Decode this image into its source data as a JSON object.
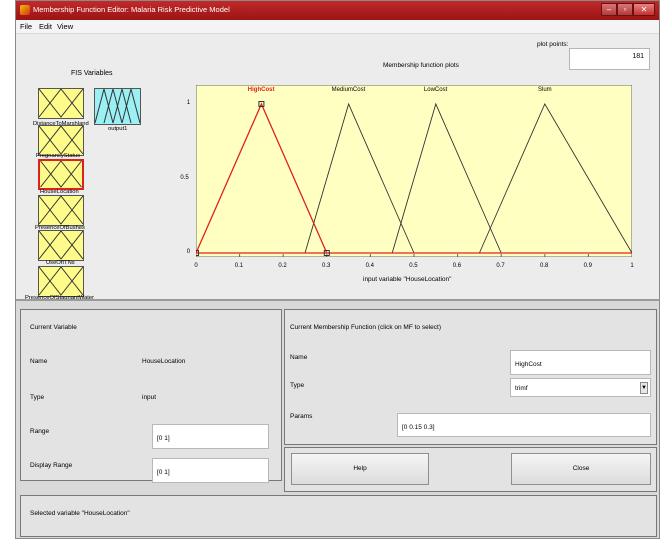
{
  "window": {
    "title": "Membership Function Editor: Malaria Risk Predictive Model",
    "buttons": {
      "minimize": "–",
      "maximize": "▫",
      "close": "✕"
    }
  },
  "menu": [
    "File",
    "Edit",
    "View"
  ],
  "fis": {
    "title": "FIS Variables",
    "inputs": [
      "DistanceToMarshland",
      "PregnancyStatus",
      "HouseLocation",
      "PresenceOfBushes",
      "UseOfITNs",
      "PresenceOfStagnantWater"
    ],
    "output": "output1",
    "selected": "HouseLocation"
  },
  "plot": {
    "title": "Membership function plots",
    "plot_points_label": "plot points:",
    "plot_points_value": "181",
    "xlabel": "input variable \"HouseLocation\"",
    "colors": {
      "selected": "#e02020",
      "other": "#333333",
      "background": "#ffffc2"
    }
  },
  "chart_data": {
    "type": "line",
    "xlim": [
      0,
      1
    ],
    "ylim": [
      0,
      1
    ],
    "x_ticks": [
      "0",
      "0.1",
      "0.2",
      "0.3",
      "0.4",
      "0.5",
      "0.6",
      "0.7",
      "0.8",
      "0.9",
      "1"
    ],
    "y_ticks": [
      "0",
      "0.5",
      "1"
    ],
    "series": [
      {
        "name": "HighCost",
        "params": [
          0,
          0.15,
          0.3
        ],
        "selected": true
      },
      {
        "name": "MediumCost",
        "params": [
          0.25,
          0.35,
          0.5
        ],
        "selected": false
      },
      {
        "name": "LowCost",
        "params": [
          0.45,
          0.55,
          0.7
        ],
        "selected": false
      },
      {
        "name": "Slum",
        "params": [
          0.65,
          0.8,
          1
        ],
        "selected": false
      }
    ]
  },
  "current_variable": {
    "title": "Current Variable",
    "name_label": "Name",
    "name_value": "HouseLocation",
    "type_label": "Type",
    "type_value": "input",
    "range_label": "Range",
    "range_value": "[0 1]",
    "display_range_label": "Display Range",
    "display_range_value": "[0 1]"
  },
  "current_mf": {
    "title": "Current Membership Function (click on MF to select)",
    "name_label": "Name",
    "name_value": "HighCost",
    "type_label": "Type",
    "type_value": "trimf",
    "params_label": "Params",
    "params_value": "[0 0.15 0.3]"
  },
  "buttons": {
    "help": "Help",
    "close": "Close"
  },
  "status": "Selected variable \"HouseLocation\""
}
